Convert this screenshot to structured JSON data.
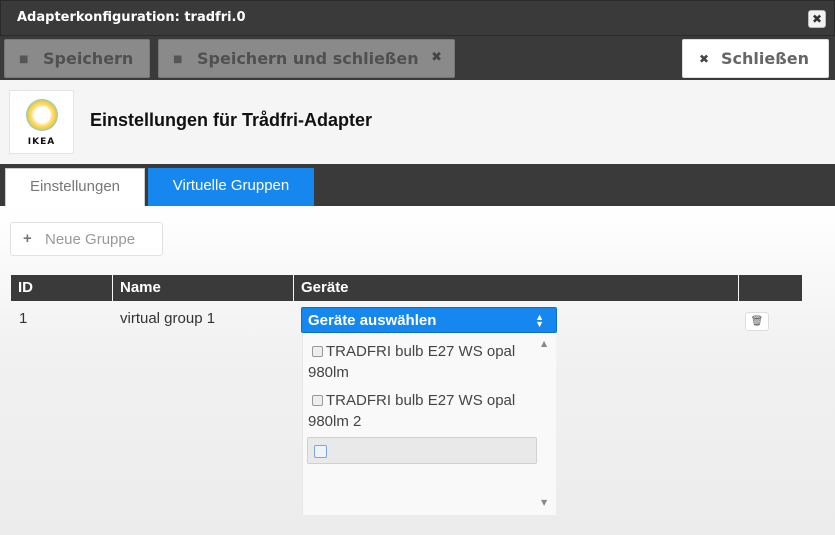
{
  "window": {
    "title": "Adapterkonfiguration: tradfri.0",
    "close_glyph": "✖"
  },
  "toolbar": {
    "save_label": "Speichern",
    "save_close_label": "Speichern und schließen",
    "close_label": "Schließen",
    "save_icon": "floppy-icon",
    "close_icon": "x-icon"
  },
  "header": {
    "logo_text": "IKEA",
    "heading": "Einstellungen für Trådfri-Adapter"
  },
  "tabs": [
    {
      "label": "Einstellungen",
      "active": false
    },
    {
      "label": "Virtuelle Gruppen",
      "active": true
    }
  ],
  "groups": {
    "add_label": "Neue Gruppe",
    "columns": [
      "ID",
      "Name",
      "Geräte",
      ""
    ],
    "rows": [
      {
        "id": "1",
        "name": "virtual group 1",
        "device_select_label": "Geräte auswählen",
        "device_options": [
          "TRADFRI bulb E27 WS opal 980lm",
          "TRADFRI bulb E27 WS opal 980lm 2"
        ]
      }
    ]
  },
  "colors": {
    "accent": "#1687ef",
    "dark_bar": "#3a3a3a"
  }
}
